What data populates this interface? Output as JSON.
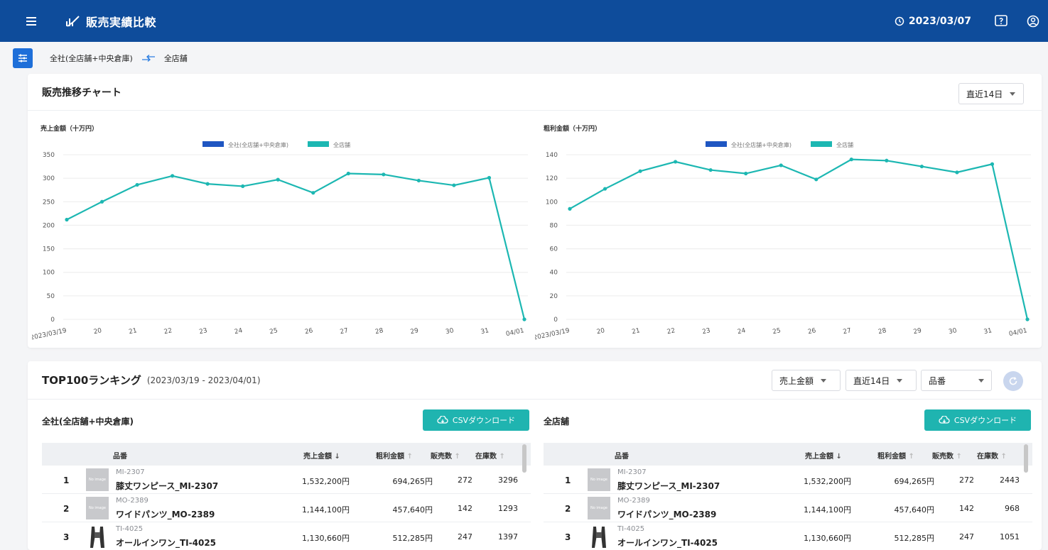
{
  "header": {
    "title": "販売実績比較",
    "date": "2023/03/07"
  },
  "breadcrumb": {
    "source": "全社(全店舗+中央倉庫)",
    "target": "全店舗"
  },
  "chart_section": {
    "title": "販売推移チャート",
    "period_select": "直近14日"
  },
  "chart_data": [
    {
      "type": "line",
      "title": "売上金額（十万円）",
      "x": [
        "2023/03/19",
        "20",
        "21",
        "22",
        "23",
        "24",
        "25",
        "26",
        "27",
        "28",
        "29",
        "30",
        "31",
        "04/01"
      ],
      "series": [
        {
          "name": "全社(全店舗+中央倉庫)",
          "values": []
        },
        {
          "name": "全店舗",
          "values": [
            212,
            250,
            286,
            305,
            288,
            283,
            297,
            269,
            310,
            308,
            295,
            285,
            301,
            0
          ]
        }
      ],
      "ylim": [
        0,
        350
      ],
      "yticks": [
        "350",
        "300",
        "250",
        "200",
        "150",
        "100",
        "50",
        "0"
      ],
      "legend": "top-center",
      "grid": true
    },
    {
      "type": "line",
      "title": "粗利金額（十万円）",
      "x": [
        "2023/03/19",
        "20",
        "21",
        "22",
        "23",
        "24",
        "25",
        "26",
        "27",
        "28",
        "29",
        "30",
        "31",
        "04/01"
      ],
      "series": [
        {
          "name": "全社(全店舗+中央倉庫)",
          "values": []
        },
        {
          "name": "全店舗",
          "values": [
            94,
            111,
            126,
            134,
            127,
            124,
            131,
            119,
            136,
            135,
            130,
            125,
            132,
            0
          ]
        }
      ],
      "ylim": [
        0,
        140
      ],
      "yticks": [
        "140",
        "120",
        "100",
        "80",
        "60",
        "40",
        "20",
        "0"
      ],
      "legend": "top-center",
      "grid": true
    }
  ],
  "colors": {
    "series1": "#1f56c2",
    "series2": "#1cb7b2",
    "header_bg": "#0e4c9b",
    "csv_button": "#1fb4b0"
  },
  "ranking": {
    "title": "TOP100ランキング",
    "range": "(2023/03/19 - 2023/04/01)",
    "sort_select": "売上金額",
    "period_select": "直近14日",
    "key_select": "品番",
    "csv_label": "CSVダウンロード",
    "columns": {
      "item": "品番",
      "sales": "売上金額",
      "profit": "粗利金額",
      "qty": "販売数",
      "stock": "在庫数"
    },
    "no_image": "No image",
    "panels": [
      {
        "title": "全社(全店舗+中央倉庫)",
        "rows": [
          {
            "rank": "1",
            "code": "MI-2307",
            "name": "膝丈ワンピース_MI-2307",
            "sales": "1,532,200円",
            "profit": "694,265円",
            "qty": "272",
            "stock": "3296"
          },
          {
            "rank": "2",
            "code": "MO-2389",
            "name": "ワイドパンツ_MO-2389",
            "sales": "1,144,100円",
            "profit": "457,640円",
            "qty": "142",
            "stock": "1293"
          },
          {
            "rank": "3",
            "code": "TI-4025",
            "name": "オールインワン_TI-4025",
            "sales": "1,130,660円",
            "profit": "512,285円",
            "qty": "247",
            "stock": "1397"
          }
        ]
      },
      {
        "title": "全店舗",
        "rows": [
          {
            "rank": "1",
            "code": "MI-2307",
            "name": "膝丈ワンピース_MI-2307",
            "sales": "1,532,200円",
            "profit": "694,265円",
            "qty": "272",
            "stock": "2443"
          },
          {
            "rank": "2",
            "code": "MO-2389",
            "name": "ワイドパンツ_MO-2389",
            "sales": "1,144,100円",
            "profit": "457,640円",
            "qty": "142",
            "stock": "968"
          },
          {
            "rank": "3",
            "code": "TI-4025",
            "name": "オールインワン_TI-4025",
            "sales": "1,130,660円",
            "profit": "512,285円",
            "qty": "247",
            "stock": "1051"
          }
        ]
      }
    ]
  }
}
